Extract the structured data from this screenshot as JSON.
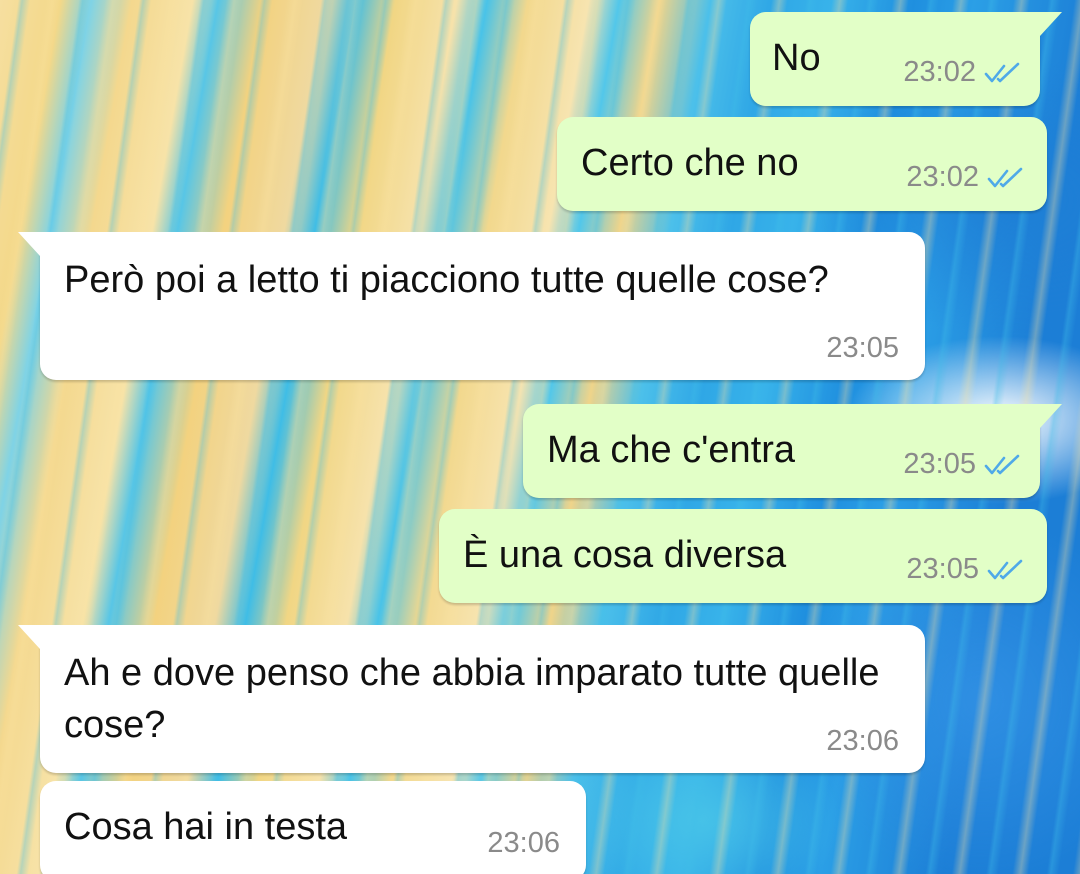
{
  "messages": [
    {
      "direction": "out",
      "text": "No",
      "time": "23:02",
      "status": "read-double-check-icon"
    },
    {
      "direction": "out",
      "text": "Certo che no",
      "time": "23:02",
      "status": "read-double-check-icon"
    },
    {
      "direction": "in",
      "text": "Però poi a letto ti piacciono tutte quelle cose?",
      "time": "23:05"
    },
    {
      "direction": "out",
      "text": "Ma che c'entra",
      "time": "23:05",
      "status": "read-double-check-icon"
    },
    {
      "direction": "out",
      "text": "È una cosa diversa",
      "time": "23:05",
      "status": "read-double-check-icon"
    },
    {
      "direction": "in",
      "text": "Ah e dove penso che abbia imparato tutte quelle cose?",
      "time": "23:06"
    },
    {
      "direction": "in",
      "text": "Cosa hai in testa",
      "time": "23:06"
    }
  ],
  "colors": {
    "outgoing_bubble": "#e2ffc7",
    "incoming_bubble": "#ffffff",
    "read_ticks": "#4fa9e8",
    "timestamp": "#8a8a8a"
  }
}
